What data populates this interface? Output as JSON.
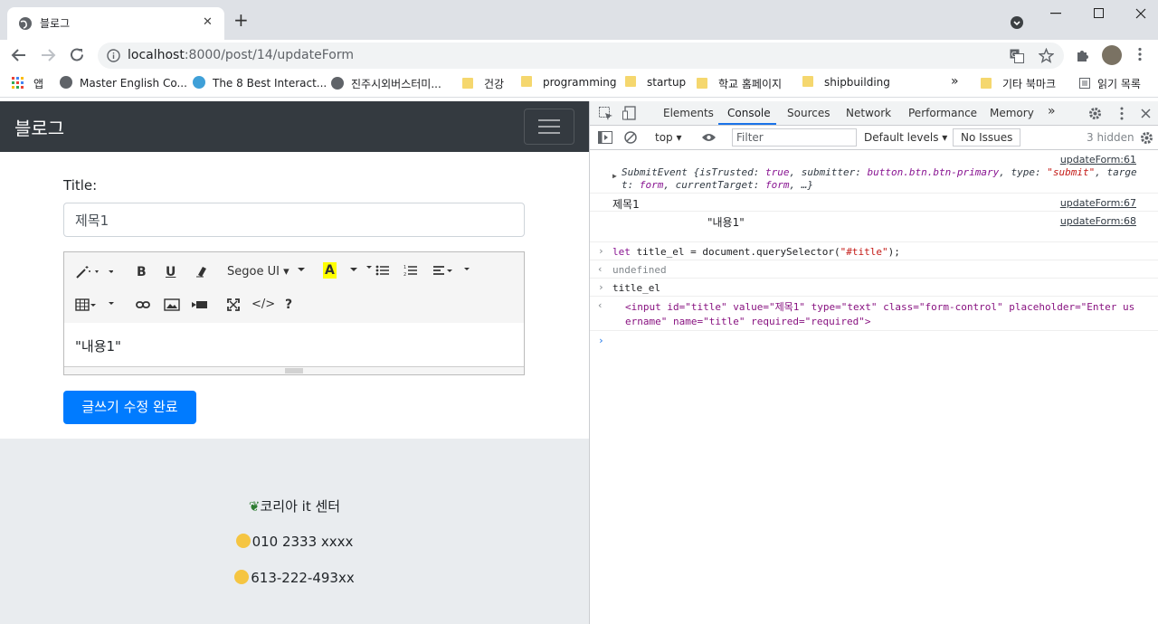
{
  "browser": {
    "tab_title": "블로그",
    "tab_close": "✕",
    "new_tab": "+",
    "url_host": "localhost",
    "url_path": ":8000/post/14/updateForm",
    "bookmarks": [
      {
        "label": "앱",
        "icon": "apps-grid-icon"
      },
      {
        "label": "Master English Co...",
        "icon": "globe-icon"
      },
      {
        "label": "The 8 Best Interact...",
        "icon": "globe-icon"
      },
      {
        "label": "진주시외버스터미...",
        "icon": "globe-icon"
      },
      {
        "label": "건강",
        "icon": "folder-icon"
      },
      {
        "label": "programming",
        "icon": "folder-icon"
      },
      {
        "label": "startup",
        "icon": "folder-icon"
      },
      {
        "label": "학교 홈페이지",
        "icon": "folder-icon"
      },
      {
        "label": "shipbuilding",
        "icon": "folder-icon"
      }
    ],
    "bookmarks_more": "»",
    "other_bookmarks": "기타 북마크",
    "reading_list": "읽기 목록"
  },
  "page": {
    "brand": "블로그",
    "title_label": "Title:",
    "title_value": "제목1",
    "font_name": "Segoe UI",
    "editor_content": "\"내용1\"",
    "submit_label": "글쓰기 수정 완료",
    "footer": {
      "company": "코리아 it 센터",
      "phone": "010 2333 xxxx",
      "fax": "613-222-493xx"
    }
  },
  "devtools": {
    "tabs": [
      "Elements",
      "Console",
      "Sources",
      "Network",
      "Performance",
      "Memory"
    ],
    "active_tab": "Console",
    "more": "»",
    "context": "top",
    "filter_placeholder": "Filter",
    "levels": "Default levels",
    "issues": "No Issues",
    "hidden": "3 hidden",
    "console": {
      "l1_src": "updateForm:61",
      "l1_a": "SubmitEvent {isTrusted: ",
      "l1_b": "true",
      "l1_c": ", submitter: ",
      "l1_d": "button.btn.btn-primary",
      "l1_e": ", type: ",
      "l1_f": "\"submit\"",
      "l1_g": ", targe",
      "l1_h": "t: ",
      "l1_i": "form",
      "l1_j": ", currentTarget: ",
      "l1_k": "form",
      "l1_l": ", …}",
      "l2_text": "제목1",
      "l2_src": "updateForm:67",
      "l3_text": "\"내용1\"",
      "l3_src": "updateForm:68",
      "l4_a": "let",
      "l4_b": " title_el = document.querySelector(",
      "l4_c": "\"#title\"",
      "l4_d": ");",
      "l5_text": "undefined",
      "l6_text": "title_el",
      "l7_html1": "<input id=\"title\" value=\"제목1\" type=\"text\" class=\"form-control\" placeholder=\"Enter us",
      "l7_html2": "ername\" name=\"title\" required=\"required\">"
    }
  }
}
